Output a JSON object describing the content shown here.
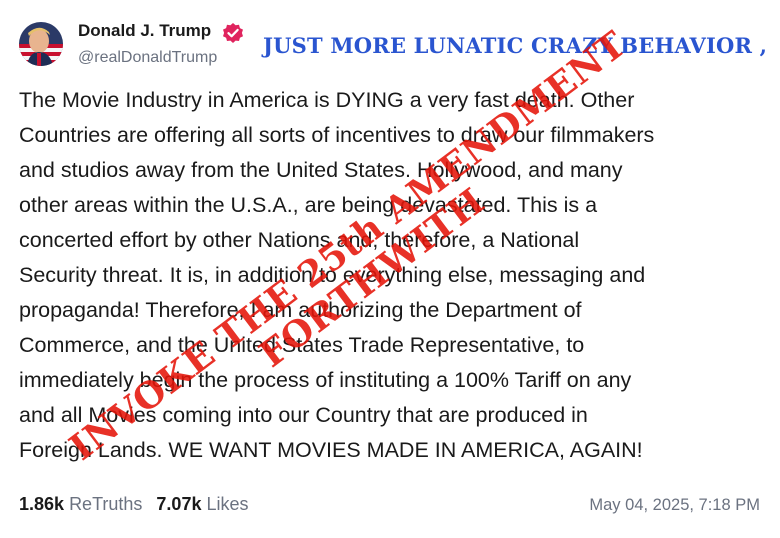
{
  "author": {
    "display_name": "Donald J. Trump",
    "handle": "@realDonaldTrump",
    "avatar_icon": "profile-photo-avatar",
    "verified_icon": "verified-badge-icon",
    "verified_color": "#e0245e"
  },
  "overlay": {
    "headline": "JUST MORE LUNATIC  CRAZY BEHAVIOR ,",
    "headline_color": "#2a55d0",
    "stamp_line1": "INVOKE THE 25th AMENDMENT",
    "stamp_line2": "FORTHWITH",
    "stamp_color": "#e51509"
  },
  "post": {
    "lines": [
      "The Movie Industry in America is DYING a very fast death. Other",
      "Countries are offering all sorts of incentives to draw our filmmakers",
      "and studios away from the United States. Hollywood, and many",
      "other areas within the U.S.A., are being devastated. This is a",
      "concerted effort by other Nations and, therefore, a National",
      "Security threat. It is, in addition to everything else, messaging and",
      "propaganda! Therefore, I am authorizing the Department of",
      "Commerce, and the United States Trade Representative, to",
      "immediately begin the process of instituting a 100% Tariff on any",
      "and all Movies coming into our Country that are produced in",
      "Foreign Lands. WE WANT MOVIES MADE IN AMERICA, AGAIN!"
    ]
  },
  "stats": {
    "retruths_count": "1.86k",
    "retruths_label": "ReTruths",
    "likes_count": "7.07k",
    "likes_label": "Likes"
  },
  "timestamp": "May 04, 2025, 7:18 PM"
}
